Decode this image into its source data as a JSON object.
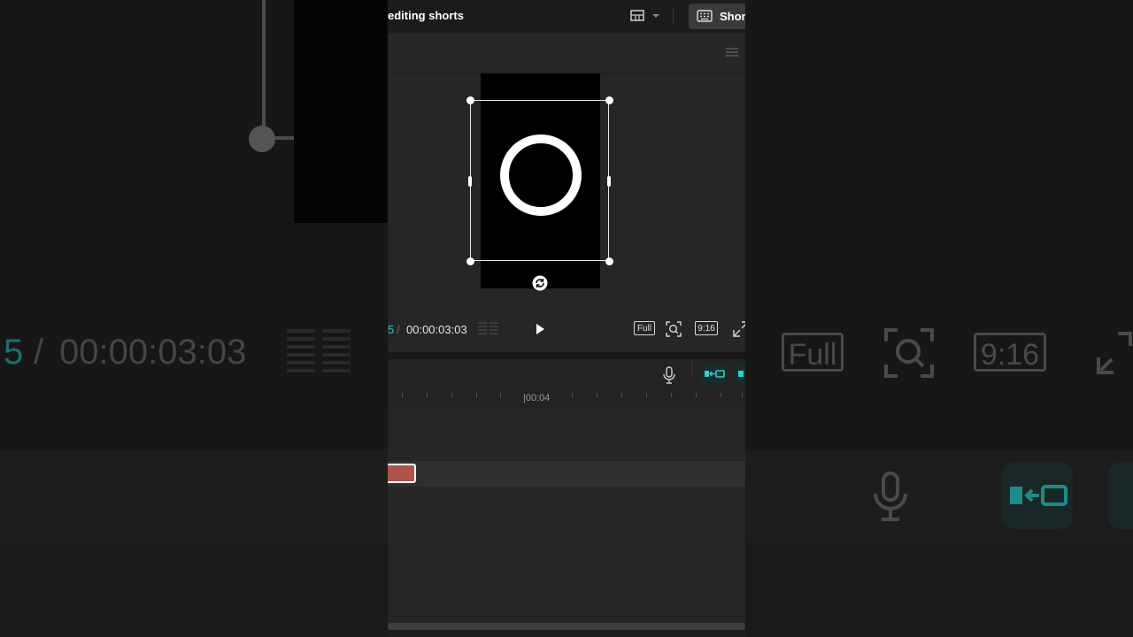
{
  "header": {
    "title": "editing shorts",
    "shortcut_label": "Shor"
  },
  "player": {
    "current_time": "5",
    "separator": "/",
    "total_time": "00:00:03:03",
    "full_label": "Full",
    "ratio_label": "9:16"
  },
  "timeline": {
    "ruler_label": "|00:04"
  },
  "background_copy": {
    "current_time": "5",
    "separator": "/",
    "total_time": "00:00:03:03",
    "full_label": "Full",
    "ratio_label": "9:16"
  },
  "icons": {
    "layout": "layout-grid-icon",
    "shortcut": "keyboard-icon",
    "menu": "hamburger-menu-icon",
    "rotate": "rotate-icon",
    "play": "play-icon",
    "zoom": "zoom-fit-icon",
    "fullscreen": "fullscreen-icon",
    "mic": "microphone-icon",
    "magnet": "magnet-link-icon"
  },
  "colors": {
    "accent": "#29c3c3",
    "clip": "#b0524a",
    "background": "#222222"
  }
}
